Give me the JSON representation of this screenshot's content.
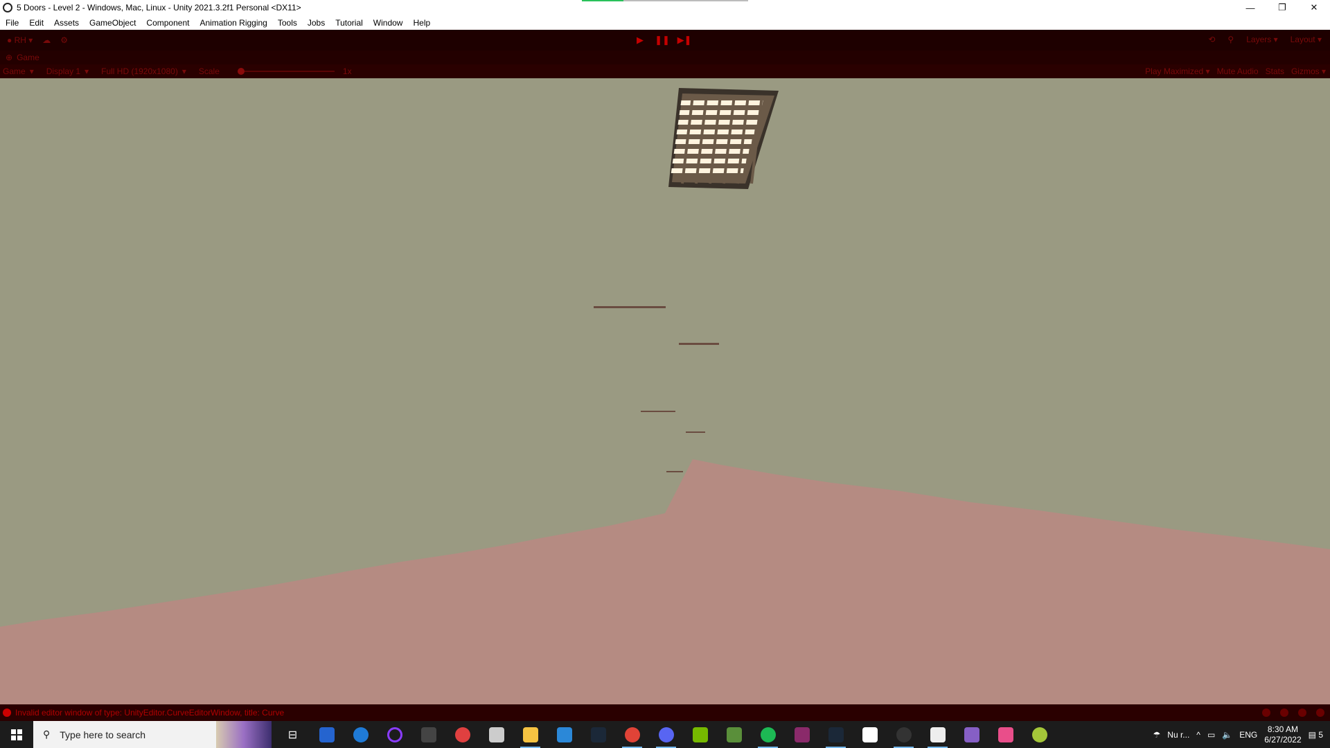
{
  "window": {
    "title": "5 Doors - Level 2 - Windows, Mac, Linux - Unity 2021.3.2f1 Personal <DX11>",
    "progress_fraction": 0.25,
    "minimize": "—",
    "restore": "❐",
    "close": "✕"
  },
  "menu": [
    "File",
    "Edit",
    "Assets",
    "GameObject",
    "Component",
    "Animation Rigging",
    "Tools",
    "Jobs",
    "Tutorial",
    "Window",
    "Help"
  ],
  "toolbar": {
    "account_label": "RH",
    "play_icon": "▶",
    "pause_icon": "❚❚",
    "step_icon": "▶❚",
    "layers_label": "Layers",
    "layout_label": "Layout"
  },
  "game_tab": {
    "label": "Game"
  },
  "game_bar": {
    "view_mode": "Game",
    "display": "Display 1",
    "resolution": "Full HD (1920x1080)",
    "scale_label": "Scale",
    "scale_value": "1x",
    "play_maximized": "Play Maximized",
    "mute_audio": "Mute Audio",
    "stats": "Stats",
    "gizmos": "Gizmos"
  },
  "console": {
    "message": "Invalid editor window of type: UnityEditor.CurveEditorWindow, title: Curve"
  },
  "taskbar": {
    "search_placeholder": "Type here to search",
    "weather": "Nu r...",
    "language": "ENG",
    "time": "8:30 AM",
    "date": "6/27/2022",
    "notifications": "5"
  },
  "colors": {
    "play_mode_tint": "#1e0000",
    "viewport_bg": "#9a9a82",
    "floor": "#b58b82",
    "accent_red": "#c40000"
  }
}
